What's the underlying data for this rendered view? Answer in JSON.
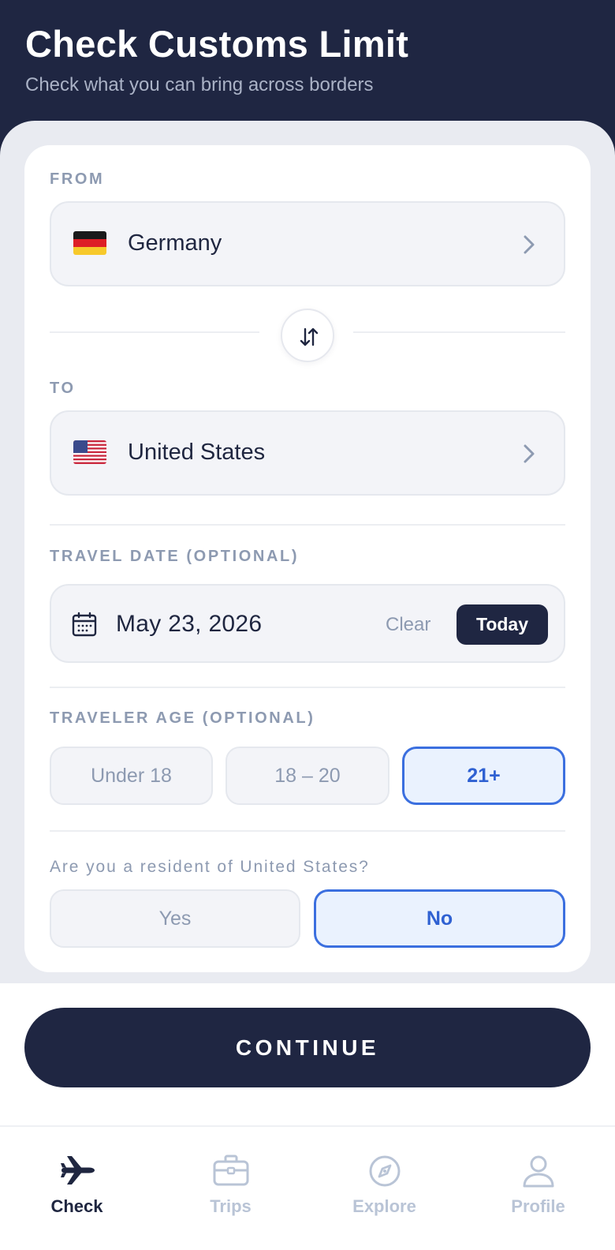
{
  "header": {
    "title": "Check Customs Limit",
    "subtitle": "Check what you can bring across borders"
  },
  "from": {
    "label": "FROM",
    "country": "Germany",
    "flag_icon": "germany-flag-icon"
  },
  "to": {
    "label": "TO",
    "country": "United States",
    "flag_icon": "us-flag-icon"
  },
  "travel_date": {
    "label": "TRAVEL DATE (OPTIONAL)",
    "value": "May 23, 2026",
    "clear_label": "Clear",
    "today_label": "Today"
  },
  "traveler_age": {
    "label": "TRAVELER AGE (OPTIONAL)",
    "options": [
      "Under 18",
      "18 – 20",
      "21+"
    ],
    "selected": "21+"
  },
  "resident": {
    "question": "Are you a resident of United States?",
    "options": [
      "Yes",
      "No"
    ],
    "selected": "No"
  },
  "continue_label": "CONTINUE",
  "tabs": [
    {
      "label": "Check",
      "icon": "airplane-icon",
      "active": true
    },
    {
      "label": "Trips",
      "icon": "briefcase-icon",
      "active": false
    },
    {
      "label": "Explore",
      "icon": "compass-icon",
      "active": false
    },
    {
      "label": "Profile",
      "icon": "person-icon",
      "active": false
    }
  ],
  "colors": {
    "header_bg": "#1f2642",
    "accent": "#3b6fdf",
    "selected_bg": "#eaf2fe",
    "muted": "#8d9ab1"
  }
}
